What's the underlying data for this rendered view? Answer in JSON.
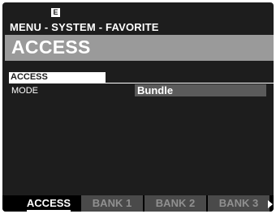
{
  "status": {
    "mode_badge": "E"
  },
  "header": {
    "breadcrumb": "MENU - SYSTEM - FAVORITE",
    "title": "ACCESS"
  },
  "section": {
    "heading": "ACCESS",
    "params": [
      {
        "label": "MODE",
        "value": "Bundle"
      }
    ]
  },
  "tabs": [
    {
      "label": "ACCESS",
      "active": true
    },
    {
      "label": "BANK 1",
      "active": false
    },
    {
      "label": "BANK 2",
      "active": false
    },
    {
      "label": "BANK 3",
      "active": false
    }
  ],
  "colors": {
    "screen_bg": "#1d1d1d",
    "title_bar": "#9a9a9a",
    "value_bg": "#5b5b5b",
    "tab_inactive_bg": "#4a4a4a",
    "tab_inactive_text": "#909090",
    "text": "#ffffff"
  }
}
